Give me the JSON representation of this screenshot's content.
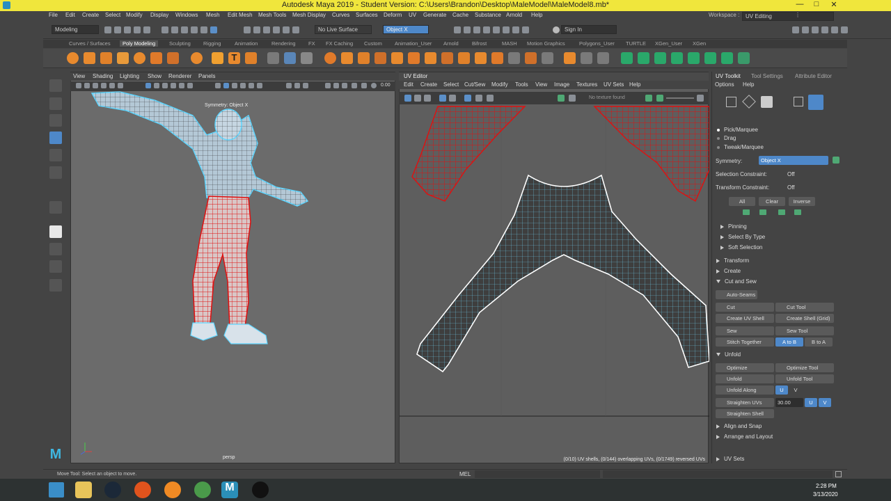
{
  "title_bar": {
    "title": "Autodesk Maya 2019 - Student Version: C:\\Users\\Brandon\\Desktop\\MaleModel\\MaleModel8.mb*"
  },
  "menu": [
    "File",
    "Edit",
    "Create",
    "Select",
    "Modify",
    "Display",
    "Windows",
    "Mesh",
    "Edit Mesh",
    "Mesh Tools",
    "Mesh Display",
    "Curves",
    "Surfaces",
    "Deform",
    "UV",
    "Generate",
    "Cache",
    "Substance",
    "Arnold",
    "Help"
  ],
  "workspace": {
    "label": "Workspace :",
    "value": "UV Editing"
  },
  "status_line": {
    "mode": "Modeling",
    "live_surface": "No Live Surface",
    "object": "Object X",
    "sign_in": "Sign In"
  },
  "shelf_tabs": [
    "Curves / Surfaces",
    "Poly Modeling",
    "Sculpting",
    "Rigging",
    "Animation",
    "Rendering",
    "FX",
    "FX Caching",
    "Custom",
    "Animation_User",
    "Arnold",
    "Bifrost",
    "MASH",
    "Motion Graphics",
    "Polygons_User",
    "TURTLE",
    "XGen_User",
    "XGen"
  ],
  "viewport": {
    "menu": [
      "View",
      "Shading",
      "Lighting",
      "Show",
      "Renderer",
      "Panels"
    ],
    "symmetry_label": "Symmetry: Object X",
    "camera": "persp",
    "field_value": "0.00"
  },
  "uv_editor": {
    "title": "UV Editor",
    "menu": [
      "Edit",
      "Create",
      "Select",
      "Cut/Sew",
      "Modify",
      "Tools",
      "View",
      "Image",
      "Textures",
      "UV Sets",
      "Help"
    ],
    "texture_status": "No texture found",
    "stats": "(0/10) UV shells, (0/144) overlapping UVs, (0/1749) reversed UVs"
  },
  "uv_toolkit": {
    "tabs": [
      "UV Toolkit",
      "Tool Settings",
      "Attribute Editor"
    ],
    "menu": [
      "Options",
      "Help"
    ],
    "modes": [
      "Pick/Marquee",
      "Drag",
      "Tweak/Marquee"
    ],
    "symmetry": {
      "label": "Symmetry:",
      "value": "Object X"
    },
    "selection_constraint": {
      "label": "Selection Constraint:",
      "value": "Off"
    },
    "transform_constraint": {
      "label": "Transform Constraint:",
      "value": "Off"
    },
    "sel_buttons": [
      "All",
      "Clear",
      "Inverse"
    ],
    "subsections": [
      "Pinning",
      "Select By Type",
      "Soft Selection"
    ],
    "sections_top": [
      "Transform",
      "Create",
      "Cut and Sew"
    ],
    "auto_seams": "Auto-Seams",
    "cut": "Cut",
    "cut_tool": "Cut Tool",
    "create_uv_shell": "Create UV Shell",
    "create_shell_grid": "Create Shell (Grid)",
    "sew": "Sew",
    "sew_tool": "Sew Tool",
    "stitch_together": "Stitch Together",
    "a_to_b": "A to B",
    "b_to_a": "B to A",
    "unfold_section": "Unfold",
    "optimize": "Optimize",
    "optimize_tool": "Optimize Tool",
    "unfold": "Unfold",
    "unfold_tool": "Unfold Tool",
    "unfold_along": "Unfold Along",
    "u": "U",
    "v": "V",
    "straighten_uvs": "Straighten UVs",
    "straighten_value": "30.00",
    "straighten_shell": "Straighten Shell",
    "sections_bottom": [
      "Align and Snap",
      "Arrange and Layout"
    ],
    "uv_sets": "UV Sets"
  },
  "status_bar": {
    "help": "Move Tool: Select an object to move.",
    "mel": "MEL"
  },
  "taskbar": {
    "time": "2:28 PM",
    "date": "3/13/2020"
  }
}
